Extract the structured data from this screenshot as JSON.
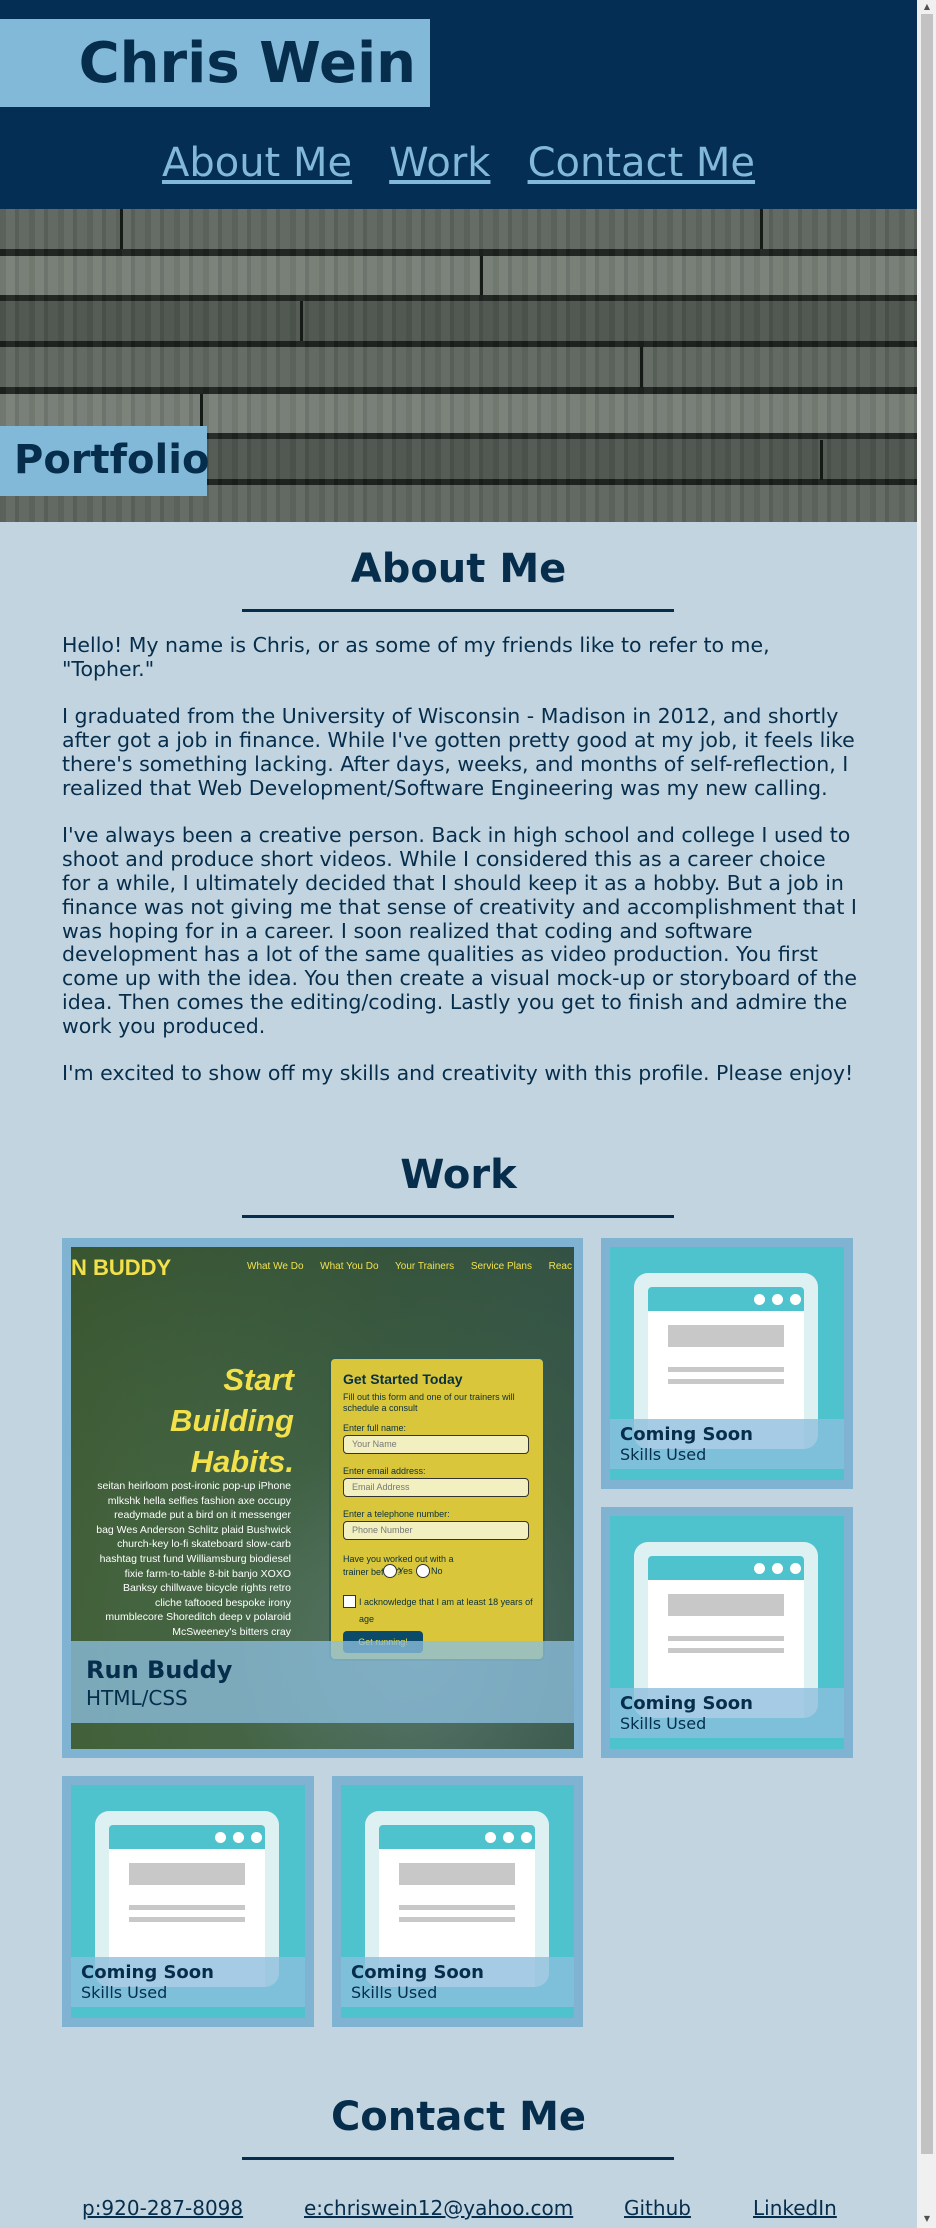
{
  "header": {
    "name": "Chris Wein",
    "nav": [
      "About Me",
      "Work",
      "Contact Me"
    ]
  },
  "hero": {
    "tag": "Portfolio"
  },
  "about": {
    "title": "About Me",
    "paragraphs": [
      "Hello! My name is Chris, or as some of my friends like to refer to me, \"Topher.\"",
      "I graduated from the University of Wisconsin - Madison in 2012, and shortly after got a job in finance. While I've gotten pretty good at my job, it feels like there's something lacking. After days, weeks, and months of self-reflection, I realized that Web Development/Software Engineering was my new calling.",
      "I've always been a creative person. Back in high school and college I used to shoot and produce short videos. While I considered this as a career choice for a while, I ultimately decided that I should keep it as a hobby. But a job in finance was not giving me that sense of creativity and accomplishment that I was hoping for in a career. I soon realized that coding and software development has a lot of the same qualities as video production. You first come up with the idea. You then create a visual mock-up or storyboard of the idea. Then comes the editing/coding. Lastly you get to finish and admire the work you produced.",
      "I'm excited to show off my skills and creativity with this profile. Please enjoy!"
    ]
  },
  "work": {
    "title": "Work",
    "featured": {
      "title": "Run Buddy",
      "skills": "HTML/CSS",
      "screenshot": {
        "logo": "N BUDDY",
        "nav": [
          "What We Do",
          "What You Do",
          "Your Trainers",
          "Service Plans",
          "Reac"
        ],
        "hero_lines": [
          "Start",
          "Building",
          "Habits."
        ],
        "hero_blurb": "seitan heirloom post-ironic pop-up iPhone mlkshk hella selfies fashion axe occupy readymade put a bird on it messenger bag Wes Anderson Schlitz plaid Bushwick church-key lo-fi skateboard slow-carb hashtag trust fund Williamsburg biodiesel fixie farm-to-table 8-bit banjo XOXO Banksy chillwave bicycle rights retro cliche taftooed bespoke irony mumblecore Shoreditch deep v polaroid McSweeney's bitters cray",
        "form_title": "Get Started Today",
        "form_intro": "Fill out this form and one of our trainers will schedule a consult",
        "labels": [
          "Enter full name:",
          "Enter email address:",
          "Enter a telephone number:"
        ],
        "placeholders": [
          "Your Name",
          "Email Address",
          "Phone Number"
        ],
        "question": "Have you worked out with a trainer before?",
        "yes": "Yes",
        "no": "No",
        "ack": "I acknowledge that I am at least 18 years of age",
        "submit": "Get running!"
      }
    },
    "placeholder_title": "Coming Soon",
    "placeholder_skills": "Skills Used"
  },
  "contact": {
    "title": "Contact Me",
    "phone": "p:920-287-8098",
    "email": "e:chriswein12@yahoo.com",
    "github": "Github",
    "linkedin": "LinkedIn"
  },
  "colors": {
    "navy": "#042e53",
    "accent": "#82b8d8",
    "background": "#c2d4df",
    "teal": "#4fc3cd"
  }
}
